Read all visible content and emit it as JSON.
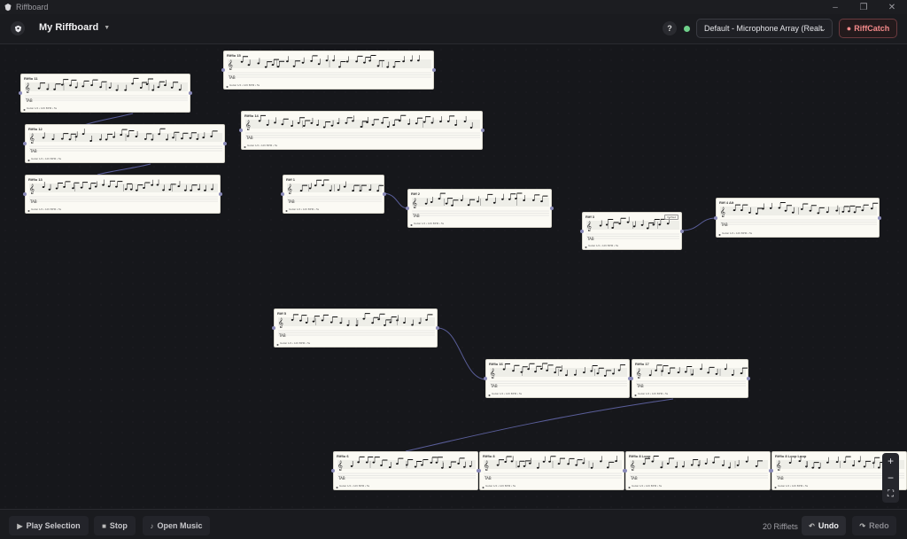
{
  "window": {
    "title": "Riffboard",
    "controls": [
      "–",
      "❐",
      "✕"
    ]
  },
  "header": {
    "board_title": "My Riffboard",
    "help_label": "?",
    "device_select_value": "Default - Microphone Array (Realt",
    "riffcatch_label": "RiffCatch",
    "status_color": "#6fd08a",
    "accent_color": "#f48a8a"
  },
  "canvas": {
    "cards": [
      {
        "id": "c1",
        "title": "Riffio 11",
        "footer": "Guitar 1/4 • 126 BPM • 5s",
        "badge": ""
      },
      {
        "id": "c2",
        "title": "Riffio 12",
        "footer": "Guitar 1/4 • 126 BPM • 5s",
        "badge": ""
      },
      {
        "id": "c3",
        "title": "Riffio 13",
        "footer": "Guitar 1/4 • 126 BPM • 5s",
        "badge": ""
      },
      {
        "id": "c4",
        "title": "Riffio 15",
        "footer": "Guitar 1/4 • 126 BPM • 5s",
        "badge": ""
      },
      {
        "id": "c5",
        "title": "Riffio 14",
        "footer": "Guitar 1/4 • 126 BPM • 5s",
        "badge": ""
      },
      {
        "id": "c6",
        "title": "Riff 1",
        "footer": "Guitar 1/4 • 126 BPM • 5s",
        "badge": ""
      },
      {
        "id": "c7",
        "title": "Riff 2",
        "footer": "Guitar 1/4 • 126 BPM • 5s",
        "badge": ""
      },
      {
        "id": "c8",
        "title": "Riff 3",
        "footer": "Guitar 1/4 • 126 BPM • 5s",
        "badge": "Verified"
      },
      {
        "id": "c9",
        "title": "Riff 4 Alt",
        "footer": "Guitar 1/4 • 126 BPM • 5s",
        "badge": ""
      },
      {
        "id": "c10",
        "title": "Riff 5",
        "footer": "Guitar 1/4 • 126 BPM • 5s",
        "badge": ""
      },
      {
        "id": "c11",
        "title": "Riffio 16",
        "footer": "Guitar 1/4 • 126 BPM • 5s",
        "badge": ""
      },
      {
        "id": "c12",
        "title": "Riffio 17",
        "footer": "Guitar 1/4 • 126 BPM • 5s",
        "badge": ""
      },
      {
        "id": "c13",
        "title": "Riffio 6",
        "footer": "Guitar 1/4 • 126 BPM • 5s",
        "badge": ""
      },
      {
        "id": "c14",
        "title": "Riffio 8",
        "footer": "Guitar 1/4 • 126 BPM • 5s",
        "badge": ""
      },
      {
        "id": "c15",
        "title": "Riffio 8 Loop",
        "footer": "Guitar 1/4 • 126 BPM • 5s",
        "badge": ""
      },
      {
        "id": "c16",
        "title": "Riffio 8 Loop Loop",
        "footer": "Guitar 1/4 • 126 BPM • 5s",
        "badge": ""
      }
    ],
    "zoom": {
      "in_label": "+",
      "out_label": "−",
      "fit_label": "⛶"
    }
  },
  "footer": {
    "play_selection_label": "Play Selection",
    "stop_label": "Stop",
    "open_music_label": "Open Music",
    "riff_count": "20 Rifflets",
    "undo_label": "Undo",
    "redo_label": "Redo"
  }
}
